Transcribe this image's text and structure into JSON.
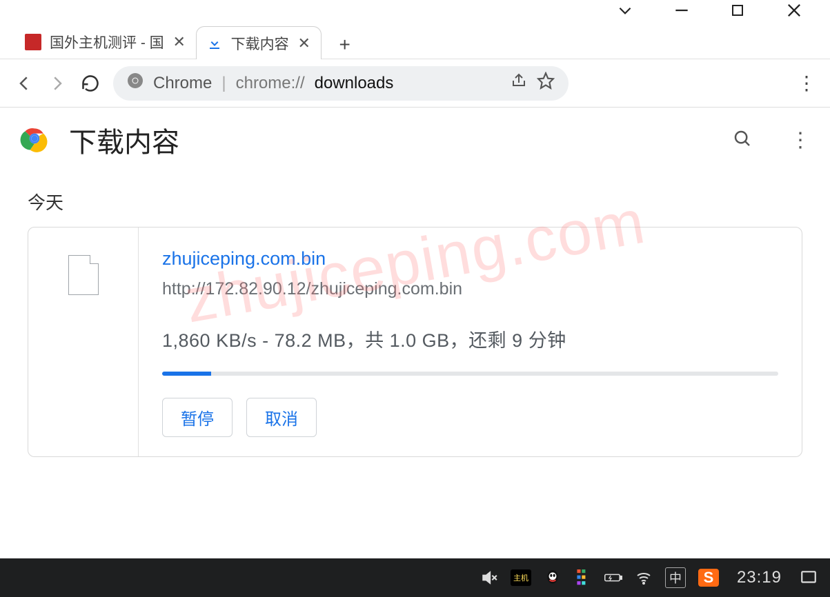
{
  "watermark": "zhujiceping.com",
  "window_controls": {
    "dropdown": "⌄",
    "minimize": "—",
    "maximize": "☐",
    "close": "✕"
  },
  "tabs": [
    {
      "label": "国外主机测评 - 国",
      "favicon_bg": "#c62828",
      "active": false
    },
    {
      "label": "下载内容",
      "favicon": "download",
      "active": true
    }
  ],
  "newtab": "+",
  "nav": {
    "back": "←",
    "forward": "→",
    "reload": "⟳"
  },
  "omnibox": {
    "scheme_label": "Chrome",
    "url_prefix": "chrome://",
    "url_path": "downloads"
  },
  "page": {
    "title": "下载内容",
    "section_today": "今天"
  },
  "download": {
    "filename": "zhujiceping.com.bin",
    "url": "http://172.82.90.12/zhujiceping.com.bin",
    "progress_text": "1,860 KB/s - 78.2 MB，共 1.0 GB，还剩 9 分钟",
    "progress_pct": 8,
    "pause_label": "暂停",
    "cancel_label": "取消"
  },
  "taskbar": {
    "ime": "中",
    "sogou": "S",
    "clock": "23:19"
  }
}
